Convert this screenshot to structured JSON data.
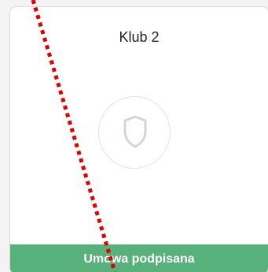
{
  "club_card": {
    "title": "Klub 2",
    "logo_icon": "shield-icon",
    "status_label": "Umowa podpisana",
    "status_color": "#58b07b"
  }
}
